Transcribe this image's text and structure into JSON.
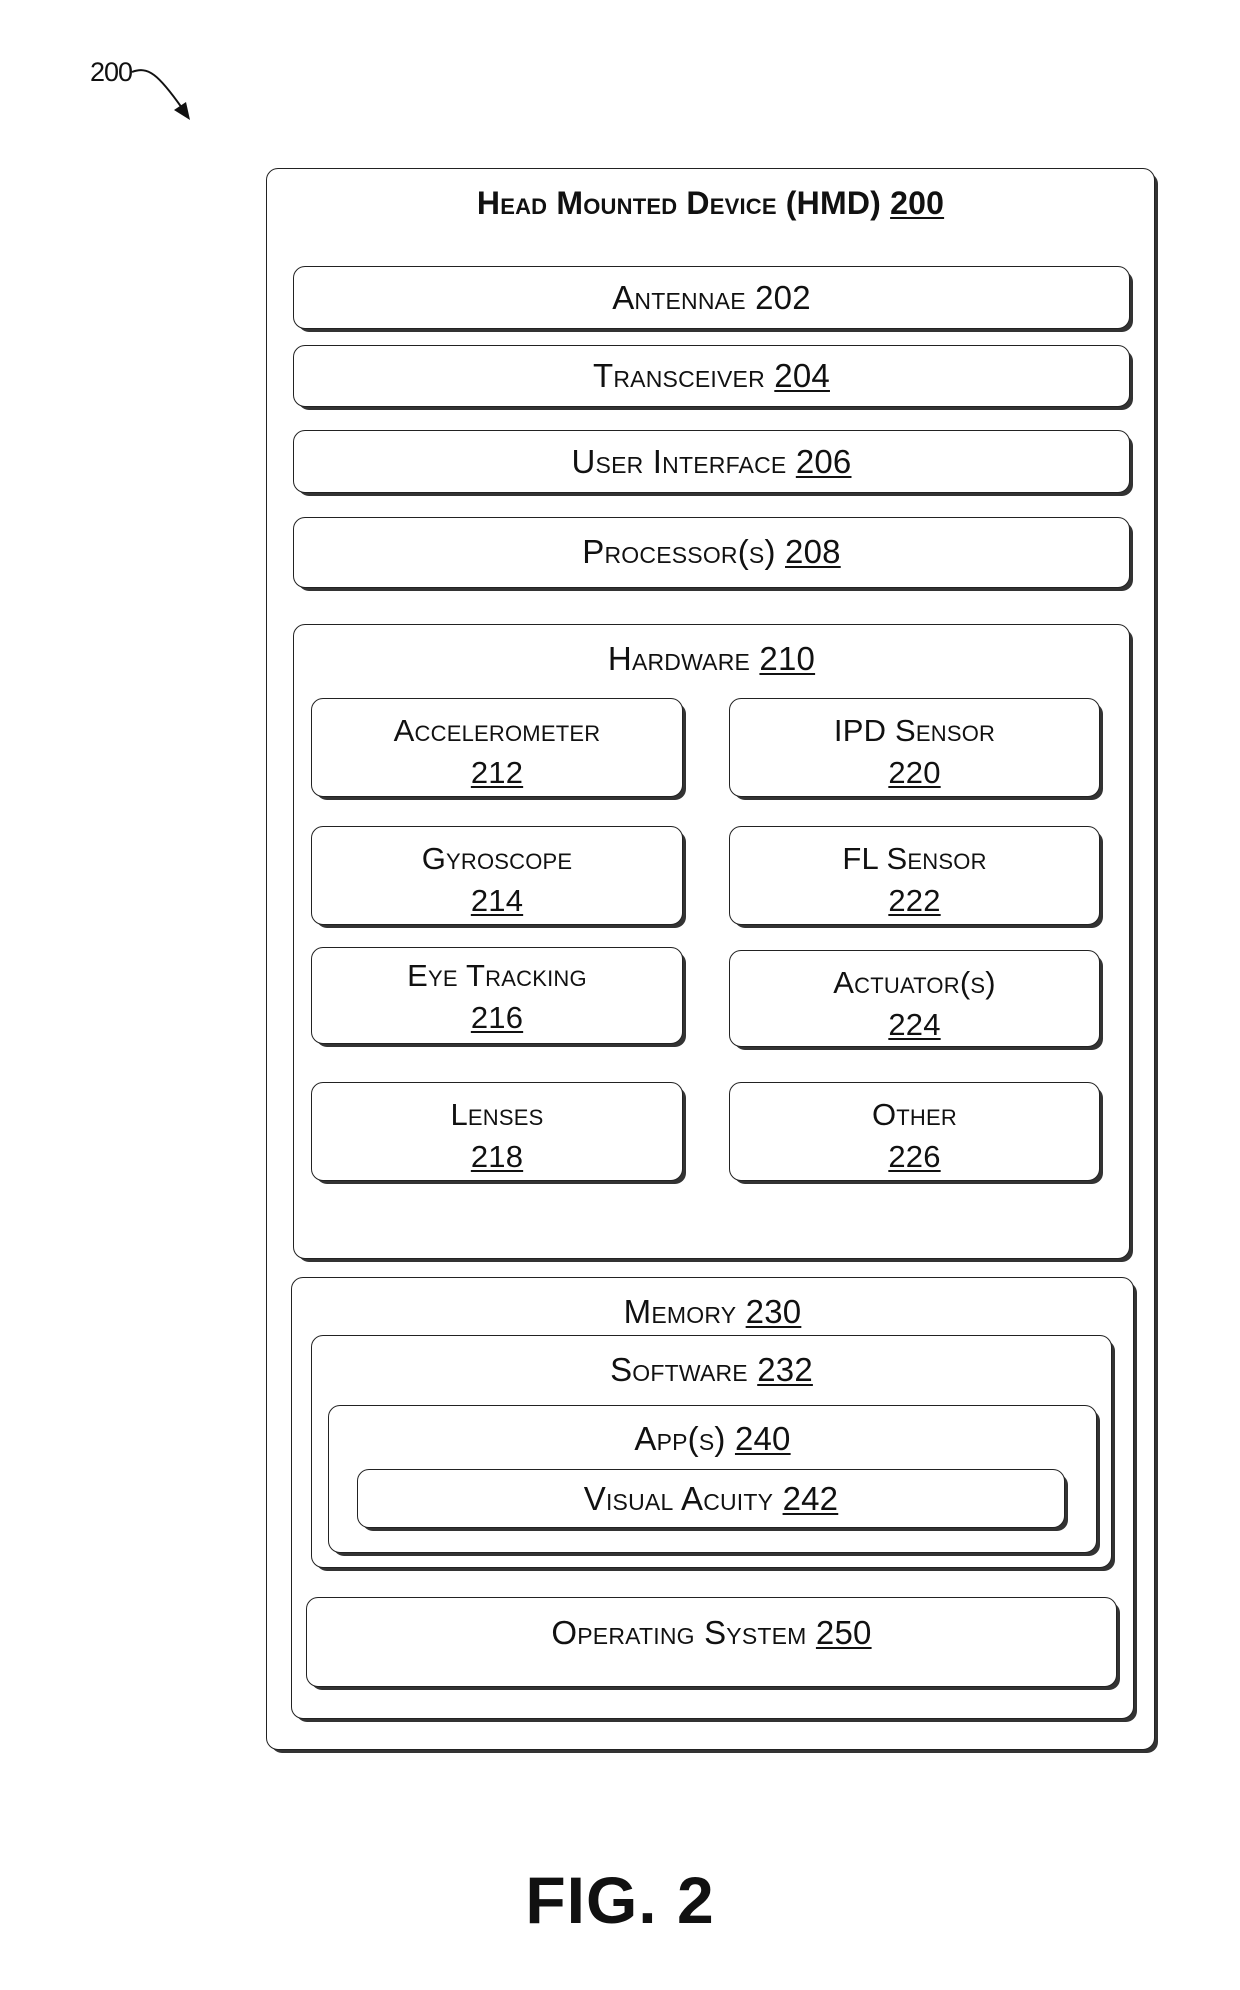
{
  "figure_ref": "200",
  "figure_caption": "FIG. 2",
  "hmd": {
    "title": "Head Mounted Device (HMD)",
    "number": "200",
    "antennae": {
      "label": "Antennae",
      "number": "202"
    },
    "transceiver": {
      "label": "Transceiver",
      "number": "204"
    },
    "user_interface": {
      "label": "User Interface",
      "number": "206"
    },
    "processors": {
      "label": "Processor(s)",
      "number": "208"
    },
    "hardware": {
      "label": "Hardware",
      "number": "210",
      "components": [
        {
          "label": "Accelerometer",
          "number": "212"
        },
        {
          "label": "IPD Sensor",
          "number": "220"
        },
        {
          "label": "Gyroscope",
          "number": "214"
        },
        {
          "label": "FL Sensor",
          "number": "222"
        },
        {
          "label": "Eye Tracking",
          "number": "216"
        },
        {
          "label": "Actuator(s)",
          "number": "224"
        },
        {
          "label": "Lenses",
          "number": "218"
        },
        {
          "label": "Other",
          "number": "226"
        }
      ]
    },
    "memory": {
      "label": "Memory",
      "number": "230",
      "software": {
        "label": "Software",
        "number": "232",
        "apps": {
          "label": "App(s)",
          "number": "240",
          "visual_acuity": {
            "label": "Visual Acuity",
            "number": "242"
          }
        }
      },
      "operating_system": {
        "label": "Operating System",
        "number": "250"
      }
    }
  }
}
